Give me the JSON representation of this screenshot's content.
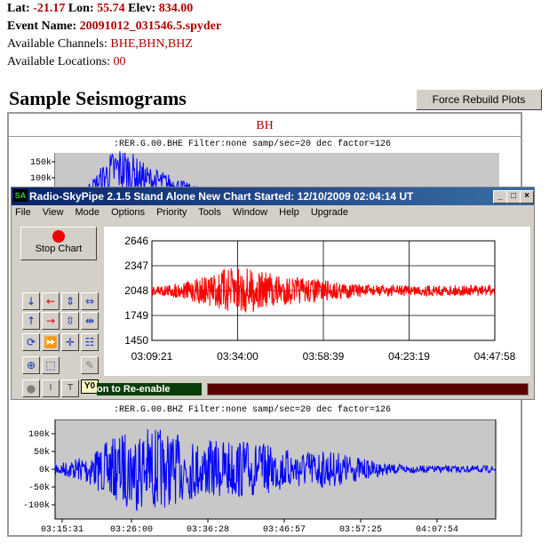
{
  "header": {
    "lat_label": "Lat:",
    "lat_value": "-21.17",
    "lon_label": "Lon:",
    "lon_value": "55.74",
    "elev_label": "Elev:",
    "elev_value": "834.00",
    "event_label": "Event Name:",
    "event_value": "20091012_031546.5.spyder",
    "channels_label": "Available Channels:",
    "channels_value": "BHE,BHN,BHZ",
    "locations_label": "Available Locations:",
    "locations_value": "00"
  },
  "section_title": "Sample Seismograms",
  "rebuild_button": "Force Rebuild Plots",
  "panel_label": "BH",
  "bhe_plot": {
    "header": ":RER.G.00.BHE   Filter:none   samp/sec=20  dec factor=126",
    "yticks_visible": [
      "150k",
      "100k"
    ]
  },
  "bhz_plot": {
    "header": ":RER.G.00.BHZ   Filter:none   samp/sec=20  dec factor=126",
    "yticks": [
      "100k",
      "50k",
      "0k",
      "-50k",
      "-100k"
    ],
    "xticks": [
      "03:15:31",
      "03:26:00",
      "03:36:28",
      "03:46:57",
      "03:57:25",
      "04:07:54"
    ],
    "color": "#0000ff"
  },
  "skypipe": {
    "title": "Radio-SkyPipe  2.1.5  Stand Alone  New Chart Started: 12/10/2009 02:04:14 UT",
    "logo": "SA",
    "menu": [
      "File",
      "View",
      "Mode",
      "Options",
      "Priority",
      "Tools",
      "Window",
      "Help",
      "Upgrade"
    ],
    "stop_button": "Stop Chart",
    "status_text": "on to Re-enable",
    "y0_badge": "Y0",
    "chart": {
      "yticks": [
        "2646",
        "2347",
        "2048",
        "1749",
        "1450"
      ],
      "xticks": [
        "03:09:21",
        "03:34:00",
        "03:58:39",
        "04:23:19",
        "04:47:58"
      ],
      "color": "#ff0000"
    }
  }
}
